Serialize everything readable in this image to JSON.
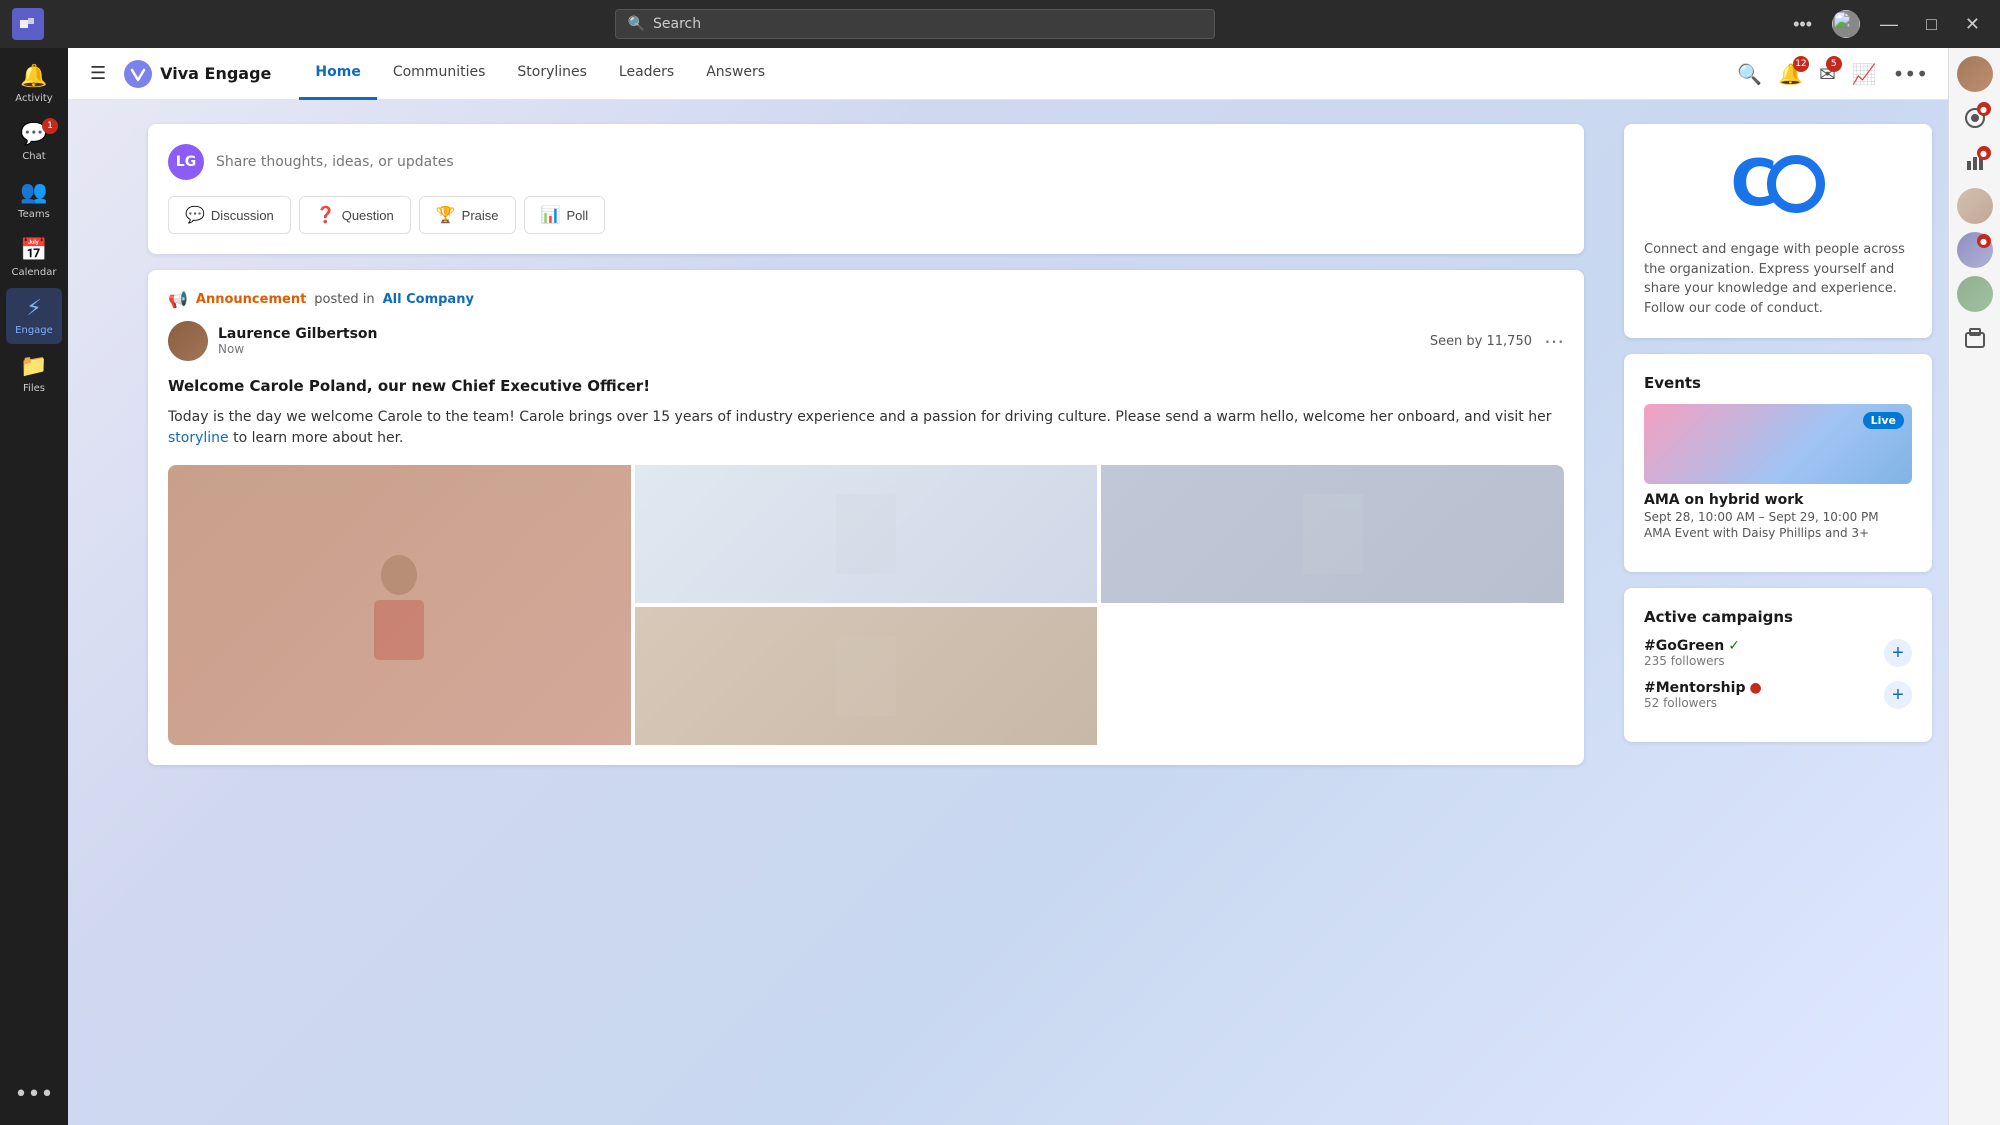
{
  "titlebar": {
    "search_placeholder": "Search",
    "more_label": "•••",
    "minimize_label": "—",
    "maximize_label": "□",
    "close_label": "✕"
  },
  "left_rail": {
    "items": [
      {
        "id": "activity",
        "label": "Activity",
        "icon": "🔔",
        "badge": null
      },
      {
        "id": "chat",
        "label": "Chat",
        "icon": "💬",
        "badge": "1"
      },
      {
        "id": "teams",
        "label": "Teams",
        "icon": "👥",
        "badge": null
      },
      {
        "id": "calendar",
        "label": "Calendar",
        "icon": "📅",
        "badge": null
      },
      {
        "id": "engage",
        "label": "Engage",
        "icon": "⚡",
        "badge": null
      },
      {
        "id": "files",
        "label": "Files",
        "icon": "📁",
        "badge": null
      }
    ],
    "more_label": "•••"
  },
  "top_nav": {
    "app_name": "Viva Engage",
    "items": [
      {
        "id": "home",
        "label": "Home",
        "active": true
      },
      {
        "id": "communities",
        "label": "Communities",
        "active": false
      },
      {
        "id": "storylines",
        "label": "Storylines",
        "active": false
      },
      {
        "id": "leaders",
        "label": "Leaders",
        "active": false
      },
      {
        "id": "answers",
        "label": "Answers",
        "active": false
      }
    ],
    "search_icon": "🔍",
    "notification_icon": "🔔",
    "notification_badge": "12",
    "mail_icon": "✉",
    "mail_badge": "5",
    "analytics_icon": "📈",
    "more_icon": "•••"
  },
  "composer": {
    "placeholder": "Share thoughts, ideas, or updates",
    "buttons": [
      {
        "id": "discussion",
        "label": "Discussion",
        "icon": "💬"
      },
      {
        "id": "question",
        "label": "Question",
        "icon": "❓"
      },
      {
        "id": "praise",
        "label": "Praise",
        "icon": "🏆"
      },
      {
        "id": "poll",
        "label": "Poll",
        "icon": "📊"
      }
    ]
  },
  "post": {
    "announcement_label": "Announcement",
    "posted_in": "posted in",
    "community": "All Company",
    "author_name": "Laurence Gilbertson",
    "author_time": "Now",
    "seen_text": "Seen by 11,750",
    "title": "Welcome Carole Poland, our new Chief Executive Officer!",
    "body_part1": "Today is the day we welcome Carole to the team! Carole brings over 15 years of industry experience and a passion for driving culture. Please send a warm hello, welcome her onboard, and visit her",
    "storyline_link": "storyline",
    "body_part2": "to learn more about her."
  },
  "community_sidebar": {
    "logo_text": "CO",
    "description": "Connect and engage with people across the organization. Express yourself and share your knowledge and experience. Follow our code of conduct."
  },
  "events": {
    "title": "Events",
    "items": [
      {
        "id": "ama",
        "live_badge": "Live",
        "title": "AMA on hybrid work",
        "date": "Sept 28, 10:00 AM – Sept 29, 10:00 PM",
        "attendees": "AMA Event with Daisy Phillips and 3+"
      }
    ]
  },
  "campaigns": {
    "title": "Active campaigns",
    "items": [
      {
        "id": "gogreen",
        "name": "#GoGreen",
        "status": "green",
        "followers": "235 followers"
      },
      {
        "id": "mentorship",
        "name": "#Mentorship",
        "status": "red",
        "followers": "52 followers"
      }
    ]
  }
}
